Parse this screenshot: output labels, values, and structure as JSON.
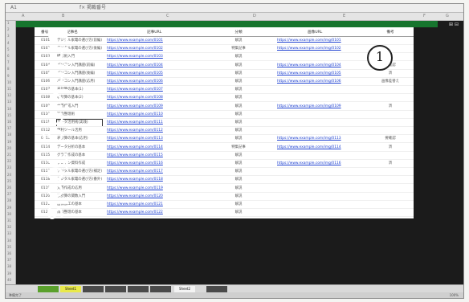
{
  "window": {
    "cell_ref": "A1",
    "formula": "f× 掲載番号"
  },
  "columns": [
    "A",
    "B",
    "C",
    "D",
    "E",
    "F",
    "G"
  ],
  "watermark": "Thinking Tools",
  "callout": "1",
  "table": {
    "headers": [
      "番号",
      "記事名",
      "記事URL",
      "分類",
      "画像URL",
      "備考"
    ],
    "rows": [
      [
        "0101",
        "デジタル家電の選び方(前編)",
        "https://www.example.com/0101",
        "解説",
        "https://www.example.com/img/0101",
        ""
      ],
      [
        "0102",
        "デジタル家電の選び方(後編)",
        "https://www.example.com/0102",
        "特集記事",
        "https://www.example.com/img/0102",
        ""
      ],
      [
        "0103",
        "撮影術入門",
        "https://www.example.com/0103",
        "解説",
        "",
        ""
      ],
      [
        "0104",
        "パソコン入門講座(前編)",
        "https://www.example.com/0104",
        "解説",
        "https://www.example.com/img/0104",
        "要確認"
      ],
      [
        "0105",
        "パソコン入門講座(後編)",
        "https://www.example.com/0105",
        "解説",
        "https://www.example.com/img/0105",
        "済"
      ],
      [
        "0106",
        "パソコン入門講座(応用)",
        "https://www.example.com/0106",
        "解説",
        "https://www.example.com/img/0106",
        "画像差替え"
      ],
      [
        "0107",
        "表計算の基本(1)",
        "https://www.example.com/0107",
        "解説",
        "",
        ""
      ],
      [
        "0108",
        "表計算の基本(2)",
        "https://www.example.com/0108",
        "解説",
        "",
        ""
      ],
      [
        "0109",
        "文書作成入門",
        "https://www.example.com/0109",
        "解説",
        "https://www.example.com/img/0109",
        "済"
      ],
      [
        "0110",
        "写真整理術",
        "https://www.example.com/0110",
        "解説",
        "",
        ""
      ],
      [
        "0111",
        "データ活用術(実践)",
        "https://www.example.com/0111",
        "解説",
        "",
        ""
      ],
      [
        "0112",
        "便利ツール活用",
        "https://www.example.com/0112",
        "解説",
        "",
        ""
      ],
      [
        "0113",
        "表計算の基本(応用)",
        "https://www.example.com/0113",
        "解説",
        "https://www.example.com/img/0113",
        "要確認"
      ],
      [
        "0114",
        "データ分析の基本",
        "https://www.example.com/0114",
        "特集記事",
        "https://www.example.com/img/0114",
        "済"
      ],
      [
        "0115",
        "グラフ作成の基本",
        "https://www.example.com/0115",
        "解説",
        "",
        ""
      ],
      [
        "0116",
        "プレゼン資料作成",
        "https://www.example.com/0116",
        "解説",
        "https://www.example.com/img/0116",
        "済"
      ],
      [
        "0117",
        "デジタル家電の選び方(補足)",
        "https://www.example.com/0117",
        "解説",
        "",
        ""
      ],
      [
        "0118",
        "デジタル家電の選び方(番外)",
        "https://www.example.com/0118",
        "解説",
        "",
        ""
      ],
      [
        "0119",
        "文書作成の応用",
        "https://www.example.com/0119",
        "解説",
        "",
        ""
      ],
      [
        "0120",
        "表計算の関数入門",
        "https://www.example.com/0120",
        "解説",
        "",
        ""
      ],
      [
        "0121",
        "画像加工の基本",
        "https://www.example.com/0121",
        "解説",
        "",
        ""
      ],
      [
        "0122",
        "情報整理の基本",
        "https://www.example.com/0122",
        "解説",
        "",
        ""
      ]
    ]
  },
  "tabs": [
    "",
    "Sheet1",
    "",
    "",
    "",
    "",
    "Sheet2",
    ""
  ],
  "status": {
    "ready": "準備完了",
    "zoom": "100%"
  }
}
